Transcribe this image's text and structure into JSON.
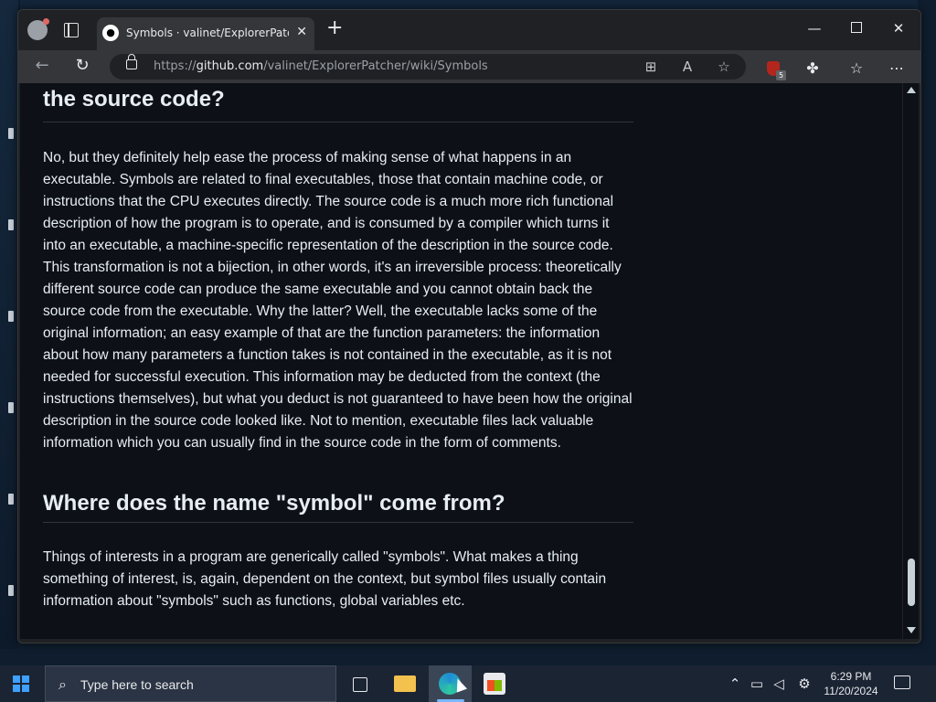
{
  "browser": {
    "tab_title": "Symbols · valinet/ExplorerPatcher",
    "tab_favicon": "github-icon",
    "url_scheme": "https://",
    "url_host": "github.com",
    "url_path": "/valinet/ExplorerPatcher/wiki/Symbols",
    "extension_badge": "5"
  },
  "page": {
    "heading_top": "the source code?",
    "paragraph_1": "No, but they definitely help ease the process of making sense of what happens in an executable. Symbols are related to final executables, those that contain machine code, or instructions that the CPU executes directly. The source code is a much more rich functional description of how the program is to operate, and is consumed by a compiler which turns it into an executable, a machine-specific representation of the description in the source code. This transformation is not a bijection, in other words, it's an irreversible process: theoretically different source code can produce the same executable and you cannot obtain back the source code from the executable. Why the latter? Well, the executable lacks some of the original information; an easy example of that are the function parameters: the information about how many parameters a function takes is not contained in the executable, as it is not needed for successful execution. This information may be deducted from the context (the instructions themselves), but what you deduct is not guaranteed to have been how the original description in the source code looked like. Not to mention, executable files lack valuable information which you can usually find in the source code in the form of comments.",
    "heading_2": "Where does the name \"symbol\" come from?",
    "paragraph_2": "Things of interests in a program are generically called \"symbols\". What makes a thing something of interest, is, again, dependent on the context, but symbol files usually contain information about \"symbols\" such as functions, global variables etc."
  },
  "taskbar": {
    "search_placeholder": "Type here to search",
    "time": "6:29 PM",
    "date": "11/20/2024"
  },
  "colors": {
    "page_bg": "#0d1117",
    "text": "#e6edf3",
    "rule": "#30363d",
    "toolbar": "#35363a",
    "taskbar": "#1b2433"
  }
}
